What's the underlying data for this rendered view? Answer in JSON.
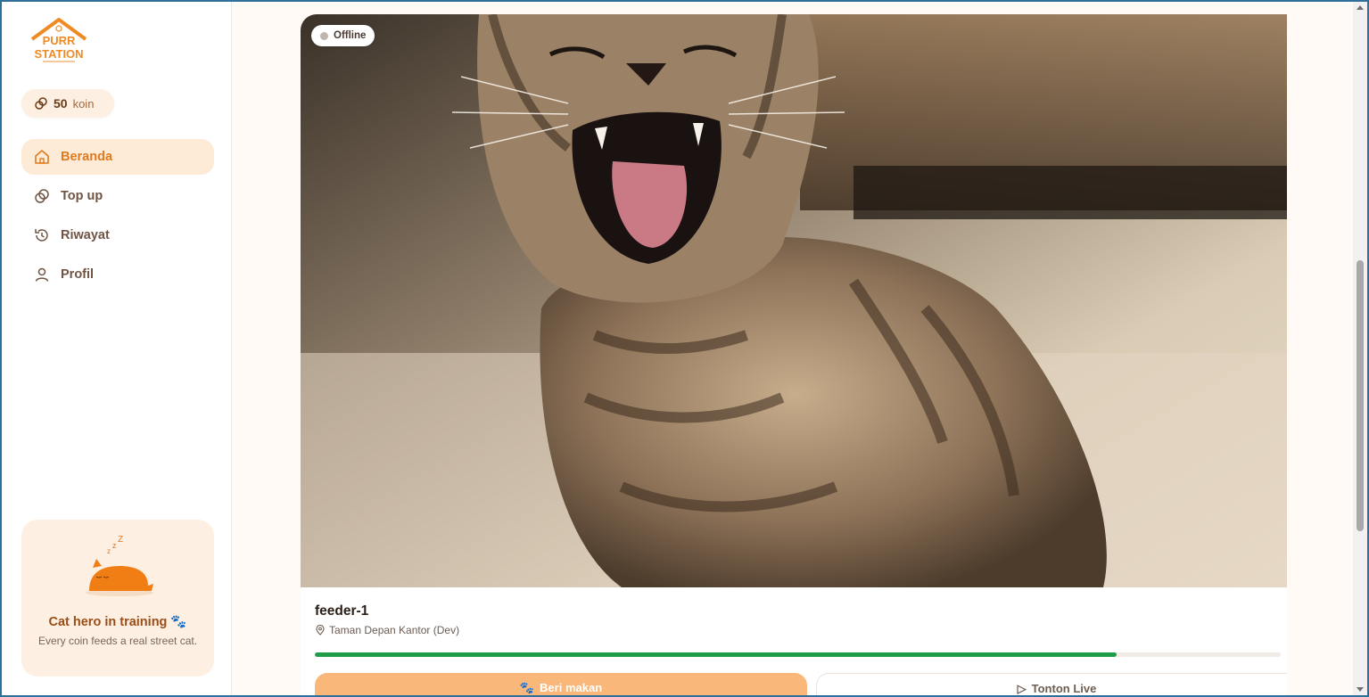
{
  "brand": {
    "logo_text_1": "PURR",
    "logo_text_2": "STATION"
  },
  "coins": {
    "amount": "50",
    "unit": "koin"
  },
  "nav": [
    {
      "label": "Beranda",
      "icon": "home-icon",
      "active": true
    },
    {
      "label": "Top up",
      "icon": "coins-icon",
      "active": false
    },
    {
      "label": "Riwayat",
      "icon": "history-icon",
      "active": false
    },
    {
      "label": "Profil",
      "icon": "user-icon",
      "active": false
    }
  ],
  "promo": {
    "title": "Cat hero in training 🐾",
    "description": "Every coin feeds a real street cat."
  },
  "feeder": {
    "status": "Offline",
    "name": "feeder-1",
    "location": "Taman Depan Kantor (Dev)",
    "progress_fraction": 0.83,
    "feed_label": "Beri makan",
    "live_label": "Tonton Live"
  },
  "colors": {
    "accent": "#e07a1f",
    "progress": "#1f9d49",
    "feed_button": "#f9b77a"
  }
}
